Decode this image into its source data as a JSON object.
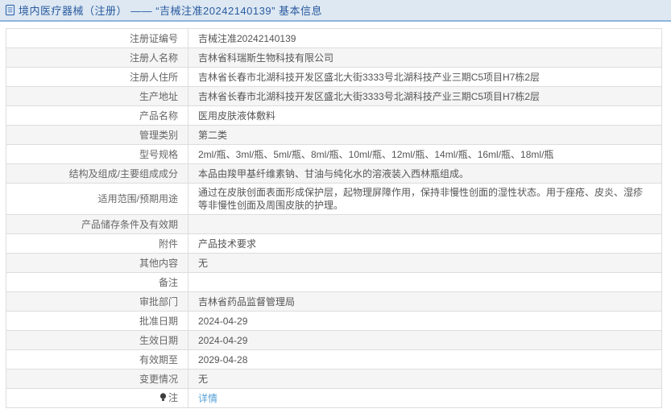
{
  "page": {
    "header": {
      "icon": "document-icon",
      "title": "境内医疗器械（注册） —— “吉械注准20242140139” 基本信息"
    },
    "colors": {
      "header_bg": "#dde8f3",
      "header_border": "#8fb4dc",
      "header_text": "#2a5a9e",
      "zebra_row": "#f5f5f5",
      "table_border": "#c9c9c9",
      "label_text": "#666666",
      "value_text": "#555555",
      "link_blue": "#559fd6"
    },
    "table": {
      "rows": [
        {
          "label": "注册证编号",
          "value": "吉械注准20242140139"
        },
        {
          "label": "注册人名称",
          "value": "吉林省科瑞斯生物科技有限公司"
        },
        {
          "label": "注册人住所",
          "value": "吉林省长春市北湖科技开发区盛北大街3333号北湖科技产业三期C5项目H7栋2层"
        },
        {
          "label": "生产地址",
          "value": "吉林省长春市北湖科技开发区盛北大街3333号北湖科技产业三期C5项目H7栋2层"
        },
        {
          "label": "产品名称",
          "value": "医用皮肤液体敷料"
        },
        {
          "label": "管理类别",
          "value": "第二类"
        },
        {
          "label": "型号规格",
          "value": "2ml/瓶、3ml/瓶、5ml/瓶、8ml/瓶、10ml/瓶、12ml/瓶、14ml/瓶、16ml/瓶、18ml/瓶"
        },
        {
          "label": "结构及组成/主要组成成分",
          "value": "本品由羧甲基纤维素钠、甘油与纯化水的溶液装入西林瓶组成。"
        },
        {
          "label": "适用范围/预期用途",
          "value": "通过在皮肤创面表面形成保护层，起物理屏障作用，保持非慢性创面的湿性状态。用于痤疮、皮炎、湿疹等非慢性创面及周围皮肤的护理。"
        },
        {
          "label": "产品储存条件及有效期",
          "value": ""
        },
        {
          "label": "附件",
          "value": "产品技术要求"
        },
        {
          "label": "其他内容",
          "value": "无"
        },
        {
          "label": "备注",
          "value": ""
        },
        {
          "label": "审批部门",
          "value": "吉林省药品监督管理局"
        },
        {
          "label": "批准日期",
          "value": "2024-04-29"
        },
        {
          "label": "生效日期",
          "value": "2024-04-29"
        },
        {
          "label": "有效期至",
          "value": "2029-04-28"
        },
        {
          "label": "变更情况",
          "value": "无"
        },
        {
          "label": "注",
          "value": "详情",
          "label_icon": "bulb-icon",
          "value_is_link": true
        }
      ]
    }
  }
}
